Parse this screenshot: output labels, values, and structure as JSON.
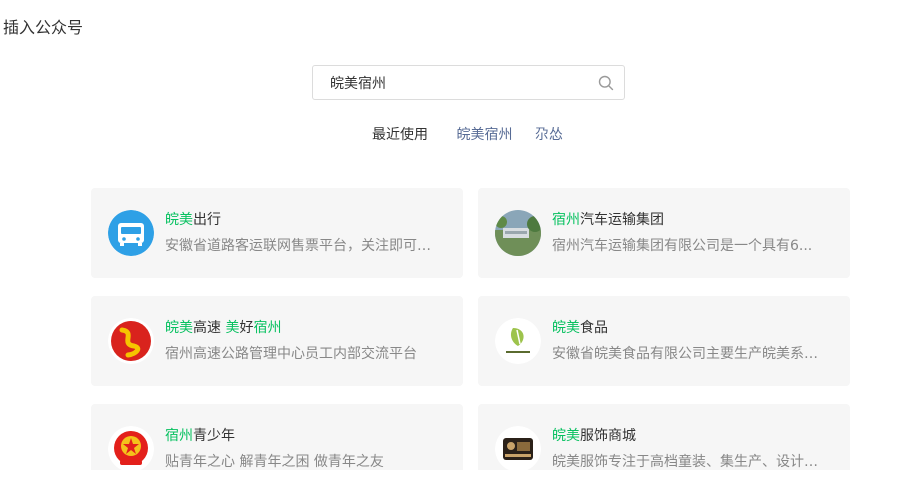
{
  "page": {
    "title": "插入公众号"
  },
  "search": {
    "value": "皖美宿州",
    "placeholder": ""
  },
  "recent": {
    "label": "最近使用",
    "tags": [
      "皖美宿州",
      "尕怂"
    ]
  },
  "results": [
    {
      "name_parts": [
        {
          "text": "皖美",
          "hl": true
        },
        {
          "text": "出行",
          "hl": false
        }
      ],
      "desc": "安徽省道路客运联网售票平台，关注即可查询和购买全省车票",
      "avatar": "bus-logo-icon"
    },
    {
      "name_parts": [
        {
          "text": "宿州",
          "hl": true
        },
        {
          "text": "汽车运输集团",
          "hl": false
        }
      ],
      "desc": "宿州汽车运输集团有限公司是一个具有6...",
      "avatar": "station-photo-icon"
    },
    {
      "name_parts": [
        {
          "text": "皖美",
          "hl": true
        },
        {
          "text": "高速 ",
          "hl": false
        },
        {
          "text": "美",
          "hl": true
        },
        {
          "text": "好",
          "hl": false
        },
        {
          "text": "宿州",
          "hl": true
        }
      ],
      "desc": "宿州高速公路管理中心员工内部交流平台",
      "avatar": "highway-logo-icon"
    },
    {
      "name_parts": [
        {
          "text": "皖美",
          "hl": true
        },
        {
          "text": "食品",
          "hl": false
        }
      ],
      "desc": "安徽省皖美食品有限公司主要生产皖美系列产品",
      "avatar": "food-logo-icon"
    },
    {
      "name_parts": [
        {
          "text": "宿州",
          "hl": true
        },
        {
          "text": "青少年",
          "hl": false
        }
      ],
      "desc": "贴青年之心 解青年之困 做青年之友",
      "avatar": "youth-league-icon"
    },
    {
      "name_parts": [
        {
          "text": "皖美",
          "hl": true
        },
        {
          "text": "服饰商城",
          "hl": false
        }
      ],
      "desc": "皖美服饰专注于高档童装、集生产、设计、销售于一体",
      "avatar": "clothing-logo-icon"
    }
  ],
  "colors": {
    "highlight": "#07c160",
    "link": "#576b95",
    "card_bg": "#f6f6f6"
  }
}
